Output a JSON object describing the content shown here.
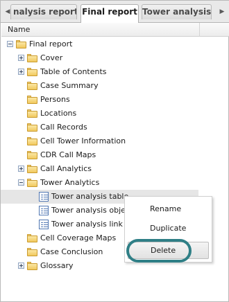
{
  "tabs": {
    "scroll_left_icon": "chevron-left-icon",
    "scroll_right_icon": "chevron-right-icon",
    "items": [
      {
        "label": "nalysis reports"
      },
      {
        "label": "Final report",
        "active": true
      },
      {
        "label": "Tower analysis"
      }
    ]
  },
  "column_header": {
    "name": "Name"
  },
  "tree": {
    "items": [
      {
        "label": "Final report",
        "icon": "folder-icon",
        "expander": "minus"
      },
      {
        "label": "Cover",
        "icon": "folder-icon",
        "expander": "plus"
      },
      {
        "label": "Table of Contents",
        "icon": "folder-icon",
        "expander": "plus"
      },
      {
        "label": "Case Summary",
        "icon": "folder-icon"
      },
      {
        "label": "Persons",
        "icon": "folder-icon"
      },
      {
        "label": "Locations",
        "icon": "folder-icon"
      },
      {
        "label": "Call Records",
        "icon": "folder-icon"
      },
      {
        "label": "Cell Tower Information",
        "icon": "folder-icon"
      },
      {
        "label": "CDR Call Maps",
        "icon": "folder-icon"
      },
      {
        "label": "Call Analytics",
        "icon": "folder-icon",
        "expander": "plus"
      },
      {
        "label": "Tower Analytics",
        "icon": "folder-icon",
        "expander": "minus"
      },
      {
        "label": "Tower analysis table",
        "icon": "table-document-icon",
        "selected": true
      },
      {
        "label": "Tower analysis object",
        "icon": "table-document-icon"
      },
      {
        "label": "Tower analysis link",
        "icon": "table-document-icon"
      },
      {
        "label": "Cell Coverage Maps",
        "icon": "folder-icon"
      },
      {
        "label": "Case Conclusion",
        "icon": "folder-icon"
      },
      {
        "label": "Glossary",
        "icon": "folder-icon",
        "expander": "plus"
      }
    ]
  },
  "context_menu": {
    "items": [
      {
        "label": "Rename"
      },
      {
        "label": "Duplicate"
      },
      {
        "label": "Delete",
        "highlighted": true
      }
    ]
  },
  "colors": {
    "highlight_ring": "#2f7f86",
    "folder": "#f1c95e",
    "selection": "#e6e6e6"
  }
}
